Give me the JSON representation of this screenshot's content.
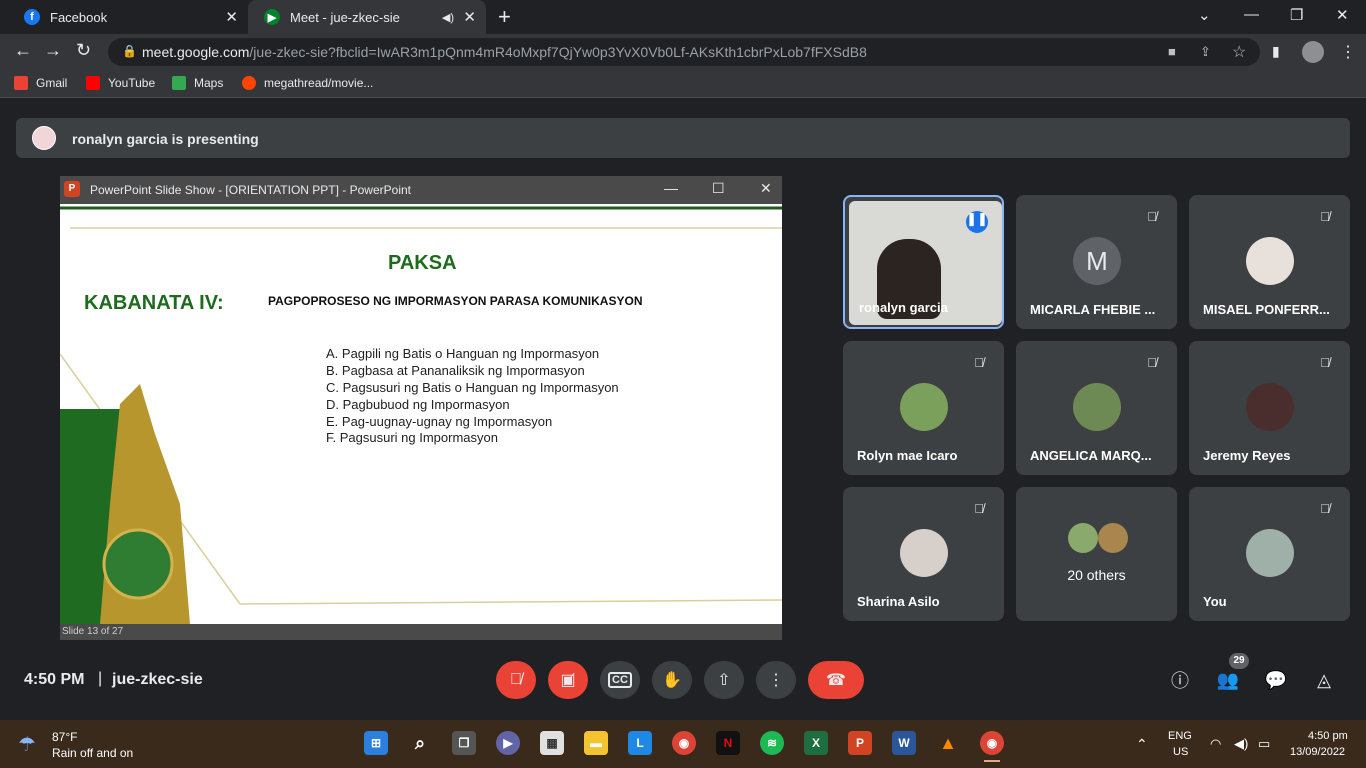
{
  "browser": {
    "tabs": [
      {
        "title": "Facebook",
        "active": false
      },
      {
        "title": "Meet - jue-zkec-sie",
        "active": true
      }
    ],
    "url_domain": "meet.google.com",
    "url_path": "/jue-zkec-sie?fbclid=IwAR3m1pQnm4mR4oMxpf7QjYw0p3YvX0Vb0Lf-AKsKth1cbrPxLob7fFXSdB8",
    "bookmarks": [
      "Gmail",
      "YouTube",
      "Maps",
      "megathread/movie..."
    ]
  },
  "meet": {
    "presenting_text": "ronalyn garcia is presenting",
    "ppt": {
      "window_title": "PowerPoint Slide Show - [ORIENTATION PPT] - PowerPoint",
      "status": "Slide 13 of 27",
      "slide": {
        "chapter": "KABANATA IV:",
        "heading": "PAKSA",
        "subheading": "PAGPOPROSESO NG IMPORMASYON PARASA KOMUNIKASYON",
        "items": [
          "A. Pagpili ng Batis o Hanguan ng Impormasyon",
          "B. Pagbasa at Pananaliksik ng Impormasyon",
          "C. Pagsusuri ng Batis o Hanguan ng Impormasyon",
          "D. Pagbubuod ng Impormasyon",
          "E. Pag-uugnay-ugnay ng Impormasyon",
          "F. Pagsusuri ng Impormasyon"
        ]
      }
    },
    "participants": [
      {
        "name": "ronalyn garcia",
        "speaking": true
      },
      {
        "name": "MICARLA FHEBIE ...",
        "initial": "M",
        "muted": true
      },
      {
        "name": "MISAEL PONFERR...",
        "muted": true
      },
      {
        "name": "Rolyn mae Icaro",
        "muted": true
      },
      {
        "name": "ANGELICA MARQ...",
        "muted": true
      },
      {
        "name": "Jeremy Reyes",
        "muted": true
      },
      {
        "name": "Sharina Asilo",
        "muted": true
      },
      {
        "name": "20 others"
      },
      {
        "name": "You",
        "muted": true
      }
    ],
    "time": "4:50 PM",
    "separator": "|",
    "meeting_code": "jue-zkec-sie",
    "people_count": "29"
  },
  "taskbar": {
    "weather_temp": "87°F",
    "weather_desc": "Rain off and on",
    "lang": "ENG",
    "region": "US",
    "time": "4:50 pm",
    "date": "13/09/2022"
  },
  "colors": {
    "meet_bg": "#202124",
    "tile_bg": "#3c4043",
    "hangup_red": "#ea4335",
    "accent_blue": "#8ab4f8",
    "slide_green": "#1e6b1e"
  }
}
